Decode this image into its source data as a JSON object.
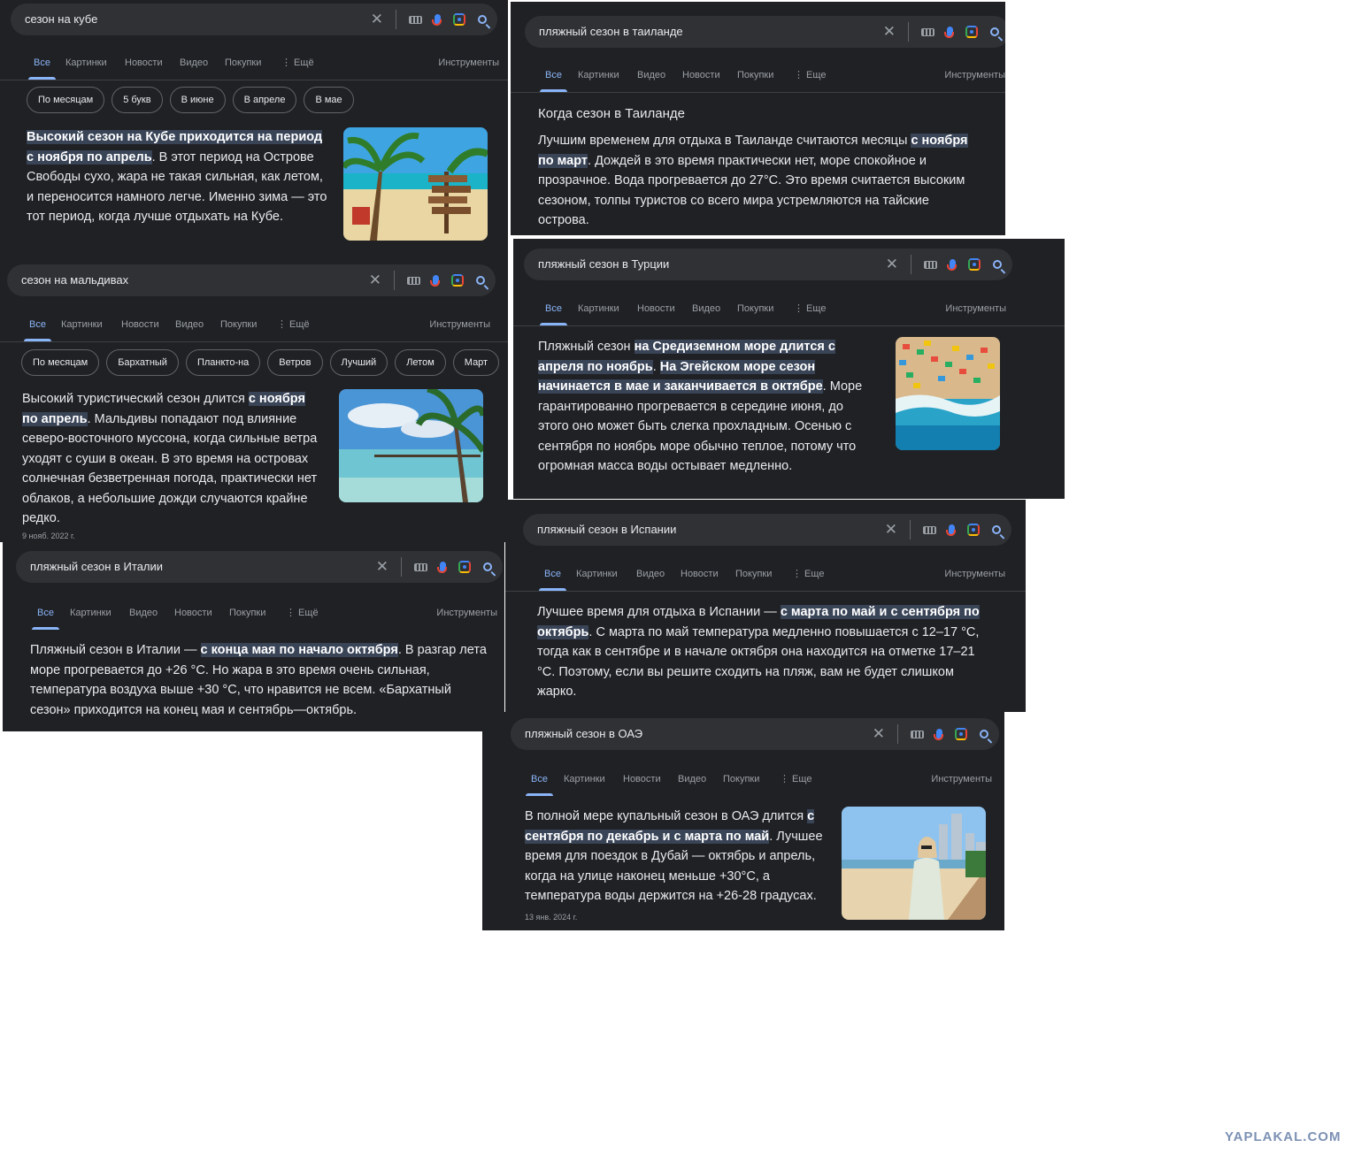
{
  "tabs_common": {
    "all": "Все",
    "images": "Картинки",
    "news": "Новости",
    "video": "Видео",
    "shopping": "Покупки",
    "more": "⋮ Ещё",
    "more_alt": "⋮ Еще",
    "tools": "Инструменты"
  },
  "cuba": {
    "query": "сезон на кубе",
    "chips": [
      "По месяцам",
      "5 букв",
      "В июне",
      "В апреле",
      "В мае"
    ],
    "hl1": "Высокий сезон на Кубе приходится на период с ноября по апрель",
    "rest": ". В этот период на Острове Свободы сухо, жара не такая сильная, как летом, и переносится намного легче. Именно зима — это тот период, когда лучше отдыхать на Кубе."
  },
  "maldives": {
    "query": "сезон на мальдивах",
    "chips": [
      "По месяцам",
      "Бархатный",
      "Планкто-на",
      "Ветров",
      "Лучший",
      "Летом",
      "Март"
    ],
    "pre": "Высокий туристический сезон длится ",
    "hl1": "с ноября по апрель",
    "rest": ". Мальдивы попадают под влияние северо-восточного муссона, когда сильные ветра уходят с суши в океан. В это время на островах солнечная безветренная погода, практически нет облаков, а небольшие дожди случаются крайне редко.",
    "date": "9 нояб. 2022 г."
  },
  "italy": {
    "query": "пляжный сезон в Италии",
    "pre": "Пляжный сезон в Италии — ",
    "hl1": "с конца мая по начало октября",
    "rest": ". В разгар лета море прогревается до +26 °С. Но жара в это время очень сильная, температура воздуха выше +30 °С, что нравится не всем. «Бархатный сезон» приходится на конец мая и сентябрь—октябрь."
  },
  "thailand": {
    "query": "пляжный сезон в таиланде",
    "heading": "Когда сезон в Таиланде",
    "pre": "Лучшим временем для отдыха в Таиланде считаются месяцы ",
    "hl1": "с ноября по март",
    "rest": ". Дождей в это время практически нет, море спокойное и прозрачное. Вода прогревается до 27°C. Это время считается высоким сезоном, толпы туристов со всего мира устремляются на тайские острова."
  },
  "turkey": {
    "query": "пляжный сезон в Турции",
    "pre": "Пляжный сезон ",
    "hl1": "на Средиземном море длится с апреля по ноябрь",
    "mid": ". ",
    "hl2": "На Эгейском море сезон начинается в мае и заканчивается в октябре",
    "rest": ". Море гарантированно прогревается в середине июня, до этого оно может быть слегка прохладным. Осенью с сентября по ноябрь море обычно теплое, потому что огромная масса воды остывает медленно."
  },
  "spain": {
    "query": "пляжный сезон в Испании",
    "pre": "Лучшее время для отдыха в Испании — ",
    "hl1": "с марта по май и с сентября по октябрь",
    "rest": ". С марта по май температура медленно повышается с 12–17 °С, тогда как в сентябре и в начале октября она находится на отметке 17–21 °С. Поэтому, если вы решите сходить на пляж, вам не будет слишком жарко."
  },
  "uae": {
    "query": "пляжный сезон в ОАЭ",
    "pre": "В полной мере купальный сезон в ОАЭ длится ",
    "hl1": "с сентября по декабрь и с марта по май",
    "rest": ". Лучшее время для поездок в Дубай — октябрь и апрель, когда на улице наконец меньше +30°С, а температура воды держится на +26-28 градусах.",
    "date": "13 янв. 2024 г."
  },
  "watermark": "YAPLAKAL.COM"
}
